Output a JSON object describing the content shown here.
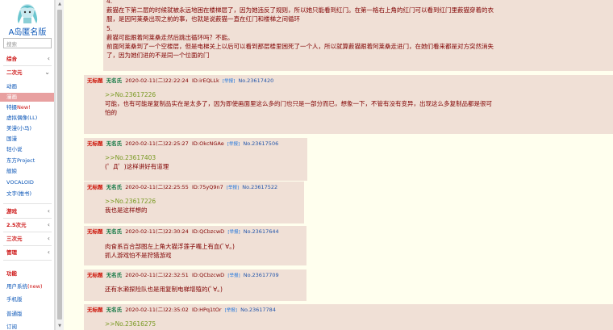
{
  "site": {
    "title": "A岛匿名版",
    "search_placeholder": "搜索"
  },
  "sidebar": {
    "cat_zonghe": "综合",
    "cat_erciyuan": "二次元",
    "erciyuan_items": [
      "动画",
      "漫画",
      "特摄",
      "New!",
      "虚拟偶像(LL)",
      "美漫(小马)",
      "国漫",
      "轻小说",
      "东方Project",
      "舰娘",
      "VOCALOID",
      "文字(推书)"
    ],
    "cat_youxi": "游戏",
    "cat_25": "2.5次元",
    "cat_sanciyuan": "三次元",
    "cat_guanli": "管理",
    "cat_gongneng": "功能",
    "func_items": [
      "用户系统",
      "(new)",
      "手机版",
      "普通版",
      "订阅"
    ]
  },
  "first_post": {
    "lines": [
      "4.",
      "薮猫在下第二层的时候就被永远地困在楼梯层了，因为她违反了规则，所以她只能看到红门。在第一格右上角的红门可以看到红门里薮猫穿着的衣",
      "服，是因阿莱桑出现之前的事，也就是说薮猫一直在红门和楼梯之间循环",
      "5.",
      "薮猫可能跟着阿莱桑走然后跳出循环吗？不能。",
      "前面阿莱桑到了一个空楼层，但是电梯关上以后可以看到那层楼里困死了一个人，所以就算薮猫跟着阿莱桑走进门，在她们看来都是对方突然消失",
      "了，因为她们进的不是同一个位面的门"
    ]
  },
  "replies": [
    {
      "title": "无标题",
      "name": "无名氏",
      "time": "2020-02-11(二)22:22:24",
      "id": "ID:irEQLLk",
      "report": "[举报]",
      "no": "No.23617420",
      "quote": ">>No.23617226",
      "text": [
        "可能，也有可能是复制品实在是太多了，因为即使画面里这么多的门也只是一部分而已，想象一下，不管有没有变异，出现这么多复制品都是很可",
        "怕的"
      ]
    },
    {
      "title": "无标题",
      "name": "无名氏",
      "time": "2020-02-11(二)22:25:27",
      "id": "ID:OkcNGAe",
      "report": "[举报]",
      "no": "No.23617506",
      "quote": ">>No.23617403",
      "text": [
        "(゜Д゜)这样讲好有道理"
      ]
    },
    {
      "title": "无标题",
      "name": "无名氏",
      "time": "2020-02-11(二)22:25:55",
      "id": "ID:75yQ9n7",
      "report": "[举报]",
      "no": "No.23617522",
      "quote": ">>No.23617226",
      "text": [
        "我也是这样想的"
      ]
    },
    {
      "title": "无标题",
      "name": "无名氏",
      "time": "2020-02-11(二)22:30:24",
      "id": "ID:QCbzcwD",
      "report": "[举报]",
      "no": "No.23617644",
      "quote": "",
      "text": [
        "肉食系百合部图左上角大猫浮莲子嘴上有血(ﾟ∀。)",
        "抓人游戏怕不是狩猎游戏"
      ]
    },
    {
      "title": "无标题",
      "name": "无名氏",
      "time": "2020-02-11(二)22:32:51",
      "id": "ID:QCbzcwD",
      "report": "[举报]",
      "no": "No.23617709",
      "quote": "",
      "text": [
        "还有水濑探险队也是用复制电梯增殖的(ﾟ∀。)"
      ]
    },
    {
      "title": "无标题",
      "name": "无名氏",
      "time": "2020-02-11(二)22:35:02",
      "id": "ID:HPq1tOr",
      "report": "[举报]",
      "no": "No.23617784",
      "quote": ">>No.23616275",
      "text": []
    }
  ]
}
